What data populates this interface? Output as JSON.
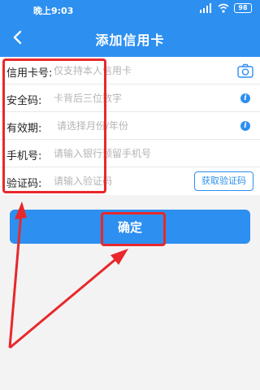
{
  "status_bar": {
    "time": "晚上9:03",
    "battery": "98"
  },
  "nav": {
    "title": "添加信用卡",
    "back_icon": "chevron-left-icon"
  },
  "form": {
    "card_number": {
      "label": "信用卡号:",
      "placeholder": "仅支持本人信用卡",
      "icon": "camera-icon"
    },
    "security_code": {
      "label": "安全码:",
      "placeholder": "卡背后三位数字",
      "icon": "info-icon"
    },
    "expiry": {
      "label": "有效期:",
      "placeholder": "请选择月份/年份",
      "icon": "info-icon"
    },
    "phone": {
      "label": "手机号:",
      "placeholder": "请输入银行预留手机号"
    },
    "verification": {
      "label": "验证码:",
      "placeholder": "请输入验证码",
      "button_label": "获取验证码"
    }
  },
  "confirm_button": {
    "label": "确定"
  },
  "colors": {
    "primary": "#2d8ff0",
    "annotation": "#e8282b"
  }
}
